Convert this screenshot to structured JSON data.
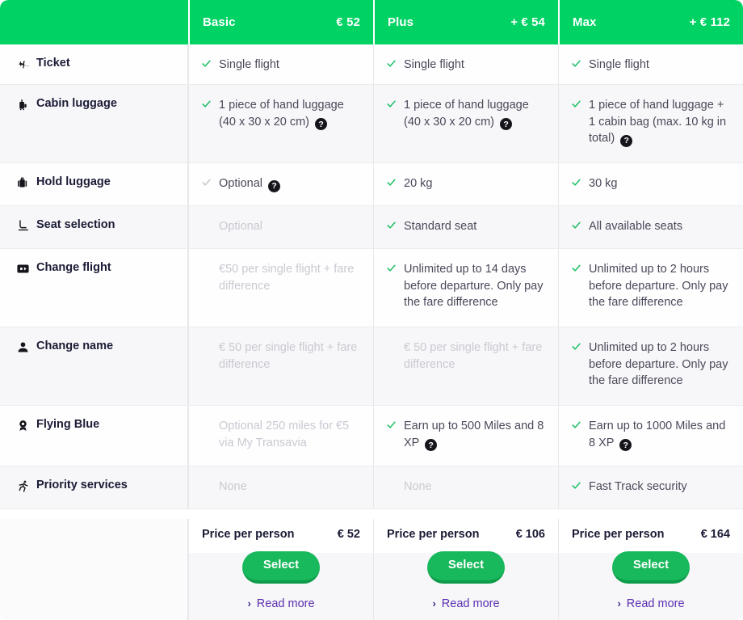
{
  "header": {
    "label_column": "",
    "fares": [
      {
        "name": "Basic",
        "price": "€ 52"
      },
      {
        "name": "Plus",
        "price": "+ € 54"
      },
      {
        "name": "Max",
        "price": "+ € 112"
      }
    ]
  },
  "colors": {
    "header_green": "#00d264",
    "check_green": "#25c16a",
    "check_muted": "#c8c8cf",
    "button_green": "#18b85c",
    "button_shadow": "#0f9c4a",
    "label_navy": "#1b1b36",
    "body_text": "#4a4a5a",
    "muted_text": "#c9c9d1",
    "link_purple": "#5b2fb0",
    "row_alt": "#f7f7f9"
  },
  "rows": [
    {
      "label": "Ticket",
      "icon": "airplane-icon",
      "cells": [
        {
          "check": "green",
          "text": "Single flight",
          "help": false,
          "muted": false
        },
        {
          "check": "green",
          "text": "Single flight",
          "help": false,
          "muted": false
        },
        {
          "check": "green",
          "text": "Single flight",
          "help": false,
          "muted": false
        }
      ]
    },
    {
      "label": "Cabin luggage",
      "icon": "cabin-luggage-icon",
      "cells": [
        {
          "check": "green",
          "text": "1 piece of hand luggage (40 x 30 x 20 cm)",
          "help": true,
          "muted": false
        },
        {
          "check": "green",
          "text": "1 piece of hand luggage (40 x 30 x 20 cm)",
          "help": true,
          "muted": false
        },
        {
          "check": "green",
          "text": "1 piece of hand luggage + 1 cabin bag (max. 10 kg in total)",
          "help": true,
          "muted": false
        }
      ]
    },
    {
      "label": "Hold luggage",
      "icon": "hold-luggage-icon",
      "cells": [
        {
          "check": "grey",
          "text": "Optional",
          "help": true,
          "muted": false
        },
        {
          "check": "green",
          "text": "20 kg",
          "help": false,
          "muted": false
        },
        {
          "check": "green",
          "text": "30 kg",
          "help": false,
          "muted": false
        }
      ]
    },
    {
      "label": "Seat selection",
      "icon": "seat-icon",
      "cells": [
        {
          "check": "none",
          "text": "Optional",
          "help": false,
          "muted": true
        },
        {
          "check": "green",
          "text": "Standard seat",
          "help": false,
          "muted": false
        },
        {
          "check": "green",
          "text": "All available seats",
          "help": false,
          "muted": false
        }
      ]
    },
    {
      "label": "Change flight",
      "icon": "change-flight-icon",
      "cells": [
        {
          "check": "none",
          "text": "€50 per single flight + fare difference",
          "help": false,
          "muted": true
        },
        {
          "check": "green",
          "text": "Unlimited up to 14 days before departure. Only pay the fare difference",
          "help": false,
          "muted": false
        },
        {
          "check": "green",
          "text": "Unlimited up to 2 hours before departure. Only pay the fare difference",
          "help": false,
          "muted": false
        }
      ]
    },
    {
      "label": "Change name",
      "icon": "person-icon",
      "cells": [
        {
          "check": "none",
          "text": "€ 50 per single flight + fare difference",
          "help": false,
          "muted": true
        },
        {
          "check": "none",
          "text": "€ 50 per single flight + fare difference",
          "help": false,
          "muted": true
        },
        {
          "check": "green",
          "text": "Unlimited up to 2 hours before departure. Only pay the fare difference",
          "help": false,
          "muted": false
        }
      ]
    },
    {
      "label": "Flying Blue",
      "icon": "medal-icon",
      "cells": [
        {
          "check": "none",
          "text": "Optional 250 miles for €5 via My Transavia",
          "help": false,
          "muted": true
        },
        {
          "check": "green",
          "text": "Earn up to 500 Miles and 8 XP",
          "help": true,
          "muted": false
        },
        {
          "check": "green",
          "text": "Earn up to 1000 Miles and 8 XP",
          "help": true,
          "muted": false
        }
      ]
    },
    {
      "label": "Priority services",
      "icon": "running-person-icon",
      "cells": [
        {
          "check": "none",
          "text": "None",
          "help": false,
          "muted": true
        },
        {
          "check": "none",
          "text": "None",
          "help": false,
          "muted": true
        },
        {
          "check": "green",
          "text": "Fast Track security",
          "help": false,
          "muted": false
        }
      ]
    }
  ],
  "footer": {
    "columns": [
      {
        "price_label": "Price per person",
        "price": "€ 52",
        "select_label": "Select",
        "read_more_label": "Read more",
        "chevron": "›"
      },
      {
        "price_label": "Price per person",
        "price": "€ 106",
        "select_label": "Select",
        "read_more_label": "Read more",
        "chevron": "›"
      },
      {
        "price_label": "Price per person",
        "price": "€ 164",
        "select_label": "Select",
        "read_more_label": "Read more",
        "chevron": "›"
      }
    ]
  }
}
